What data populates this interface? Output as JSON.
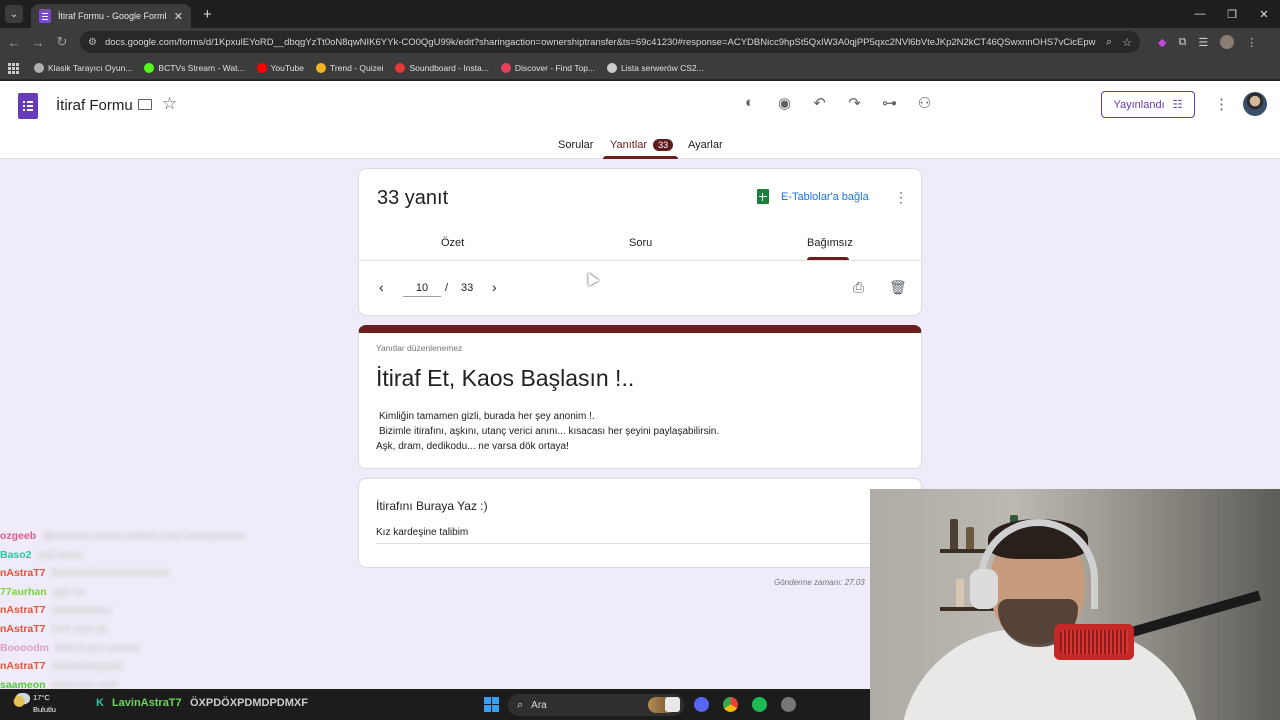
{
  "browser": {
    "tab_title": "İtiraf Formu - Google Formlar",
    "tab_close": "✕",
    "new_tab": "+",
    "window_controls": [
      "—",
      "❐",
      "✕"
    ],
    "url": "docs.google.com/forms/d/1KpxulEYoRD__dbqgYzTt0oN8qwNIK6YYk-CO0QgU99k/edit?sharingaction=ownershiptransfer&ts=69c41230#response=ACYDBNicc9hpSt5QxIW3A0qjPP5qxc2NVl6bVteJKp2N2kCT46QSwxnnOHS7vCicEpwTRtw",
    "bookmarks": [
      {
        "label": "Klasik Tarayıcı Oyun...",
        "color": "#b0b0b0"
      },
      {
        "label": "BCTVs Stream - Wat...",
        "color": "#53fc18"
      },
      {
        "label": "YouTube",
        "color": "#ff0000"
      },
      {
        "label": "Trend - Quizei",
        "color": "#f0b429"
      },
      {
        "label": "Soundboard - Insta...",
        "color": "#e53935"
      },
      {
        "label": "Discover - Find Top...",
        "color": "#e4405f"
      },
      {
        "label": "Lista serwerów CS2...",
        "color": "#cccccc"
      }
    ]
  },
  "header": {
    "form_title": "İtiraf Formu",
    "publish_label": "Yayınlandı",
    "tabs": [
      {
        "label": "Sorular"
      },
      {
        "label": "Yanıtlar",
        "badge": "33"
      },
      {
        "label": "Ayarlar"
      }
    ]
  },
  "responses": {
    "count_label": "33 yanıt",
    "sheets_link": "E-Tablolar'a bağla",
    "subtabs": [
      "Özet",
      "Soru",
      "Bağımsız"
    ],
    "current": "10",
    "separator": "/",
    "total": "33"
  },
  "form_card": {
    "notice": "Yanıtlar düzenlenemez",
    "heading": "İtiraf Et, Kaos Başlasın !..",
    "description": [
      "Kimliğin tamamen gizli, burada her şey anonim !.",
      "Bizimle itirafını, aşkını, utanç verici anını... kısacası her şeyini paylaşabilirsin.",
      "Aşk, dram, dedikodu... ne varsa dök ortaya!"
    ]
  },
  "question_card": {
    "title": "İtirafını Buraya Yaz :)",
    "answer": "Kız kardeşine talibim"
  },
  "submitted_label": "Gönderme zamanı: 27.03",
  "chat": [
    {
      "user": "ozgeeb",
      "color": "#e05a8a",
      "msg": "@sezoma sanam oldden seal hulanyarman"
    },
    {
      "user": "Baso2",
      "color": "#2ec4a0",
      "msg": "sağ olsun"
    },
    {
      "user": "nAstraT7",
      "color": "#e0573a",
      "msg": "Bahahahahahahahahaha"
    },
    {
      "user": "77aurhan",
      "color": "#7bd23e",
      "msg": "agir oo"
    },
    {
      "user": "nAstraT7",
      "color": "#e0573a",
      "msg": "Aaaaaaaaaa"
    },
    {
      "user": "nAstraT7",
      "color": "#e0573a",
      "msg": "Çok ayıp ya"
    },
    {
      "user": "Boooodm",
      "color": "#e0a0c0",
      "msg": "bildi bi şey yazarız"
    },
    {
      "user": "nAstraT7",
      "color": "#e0573a",
      "msg": "Jkosnsksjsjsjsk"
    },
    {
      "user": "saameon",
      "color": "#53c93b",
      "msg": "onun ben amk"
    }
  ],
  "taskbar": {
    "temp": "17°C",
    "weather": "Bulutlu",
    "chat_user": "LavinAstraT7",
    "chat_msg": "ÖXPDÖXPDMDPDMXF",
    "search_placeholder": "Ara"
  }
}
